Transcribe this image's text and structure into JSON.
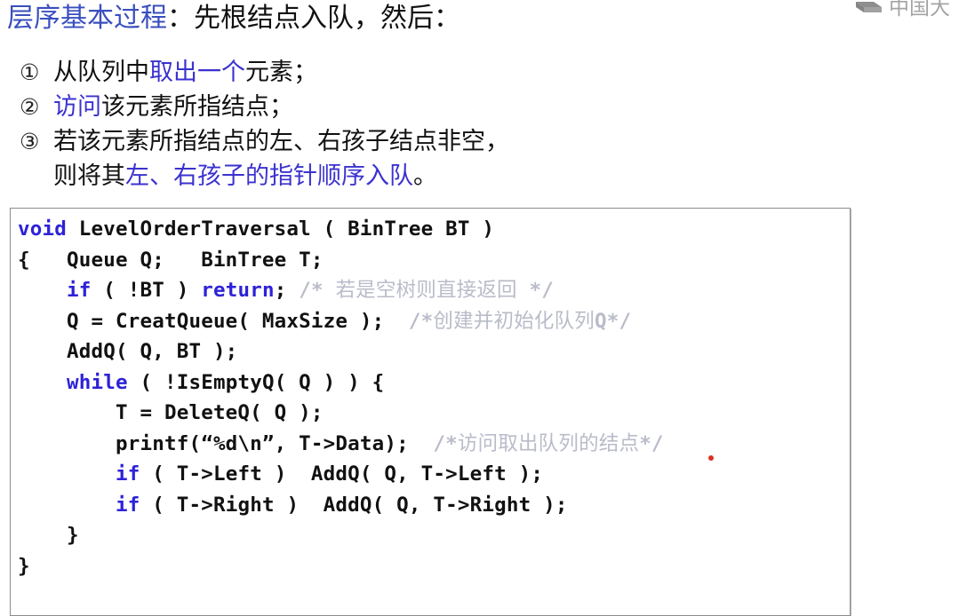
{
  "watermark": {
    "icon": "cube-logo-icon",
    "text": "中国大"
  },
  "heading": {
    "highlight": "层序基本过程",
    "rest": "：先根结点入队，然后："
  },
  "steps": [
    {
      "marker": "①",
      "segments": [
        {
          "text": "从队列中",
          "color": "black"
        },
        {
          "text": "取出一个",
          "color": "blue"
        },
        {
          "text": "元素；",
          "color": "black"
        }
      ]
    },
    {
      "marker": "②",
      "segments": [
        {
          "text": "访问",
          "color": "blue"
        },
        {
          "text": "该元素所指结点；",
          "color": "black"
        }
      ]
    },
    {
      "marker": "③",
      "segments": [
        {
          "text": "若该元素所指结点的左、右孩子结点非空，",
          "color": "black"
        }
      ],
      "line2": [
        {
          "text": "则将其",
          "color": "black"
        },
        {
          "text": "左、右孩子的指针顺序入队",
          "color": "blue"
        },
        {
          "text": "。",
          "color": "black"
        }
      ]
    }
  ],
  "code": {
    "language": "C",
    "lines": [
      [
        {
          "t": "void",
          "c": "kw"
        },
        {
          "t": " LevelOrderTraversal ( BinTree BT )",
          "c": "plain"
        }
      ],
      [
        {
          "t": "{   Queue Q;   BinTree T;",
          "c": "plain"
        }
      ],
      [
        {
          "t": "    ",
          "c": "plain"
        },
        {
          "t": "if",
          "c": "kw"
        },
        {
          "t": " ( !BT ) ",
          "c": "plain"
        },
        {
          "t": "return",
          "c": "kw"
        },
        {
          "t": "; ",
          "c": "plain"
        },
        {
          "t": "/* ",
          "c": "cm"
        },
        {
          "t": "若是空树则直接返回",
          "c": "cmz"
        },
        {
          "t": " */",
          "c": "cm"
        }
      ],
      [
        {
          "t": "    Q = CreatQueue( MaxSize );  ",
          "c": "plain"
        },
        {
          "t": "/*",
          "c": "cm"
        },
        {
          "t": "创建并初始化队列",
          "c": "cmz"
        },
        {
          "t": "Q*/",
          "c": "cm"
        }
      ],
      [
        {
          "t": "    AddQ( Q, BT );",
          "c": "plain"
        }
      ],
      [
        {
          "t": "    ",
          "c": "plain"
        },
        {
          "t": "while",
          "c": "kw"
        },
        {
          "t": " ( !IsEmptyQ( Q ) ) {",
          "c": "plain"
        }
      ],
      [
        {
          "t": "        T = DeleteQ( Q );",
          "c": "plain"
        }
      ],
      [
        {
          "t": "        printf(“%d\\n”, T->Data);  ",
          "c": "plain"
        },
        {
          "t": "/*",
          "c": "cm"
        },
        {
          "t": "访问取出队列的结点",
          "c": "cmz"
        },
        {
          "t": "*/",
          "c": "cm"
        }
      ],
      [
        {
          "t": "        ",
          "c": "plain"
        },
        {
          "t": "if",
          "c": "kw"
        },
        {
          "t": " ( T->Left )  AddQ( Q, T->Left );",
          "c": "plain"
        }
      ],
      [
        {
          "t": "        ",
          "c": "plain"
        },
        {
          "t": "if",
          "c": "kw"
        },
        {
          "t": " ( T->Right )  AddQ( Q, T->Right );",
          "c": "plain"
        }
      ],
      [
        {
          "t": "    }",
          "c": "plain"
        }
      ],
      [
        {
          "t": "}",
          "c": "plain"
        }
      ]
    ]
  },
  "colors": {
    "keyword_blue": "#2d22d8",
    "heading_blue": "#3a4fbe",
    "text_blue": "#3b32cf",
    "comment_gray": "#b9bcc9",
    "body_text": "#111111",
    "code_border": "#8c8c8c",
    "cursor_dot": "#d83225",
    "background": "#ffffff"
  }
}
